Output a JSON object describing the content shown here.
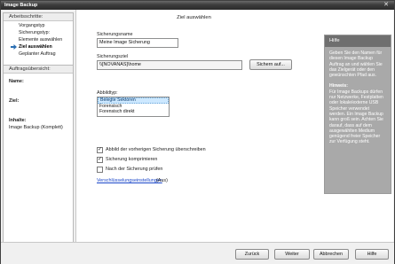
{
  "window": {
    "title": "Image Backup",
    "close_glyph": "✕"
  },
  "steps": {
    "header": "Arbeitsschritte:",
    "items": [
      {
        "label": "Vorgangstyp"
      },
      {
        "label": "Sicherungstyp:"
      },
      {
        "label": "Elemente auswählen"
      },
      {
        "label": "Ziel auswählen",
        "current": true
      },
      {
        "label": "Geplanter Auftrag"
      }
    ]
  },
  "summary": {
    "header": "Auftragsübersicht:",
    "name_label": "Name:",
    "ziel_label": "Ziel:",
    "inhalte_label": "Inhalte:",
    "inhalte_value": "Image Backup (Komplett)"
  },
  "main": {
    "title": "Ziel auswählen",
    "name_label": "Sicherungsname",
    "name_value": "Meine Image Sicherung",
    "target_label": "Sicherungsziel",
    "target_value": "\\\\[NOVANAS]\\home",
    "browse_label": "Sichern auf...",
    "image_type_label": "Abbildtyp:",
    "image_type_options": [
      {
        "label": "Belegte Sektoren",
        "selected": true
      },
      {
        "label": "Forensisch"
      },
      {
        "label": "Forensisch direkt"
      }
    ],
    "options": [
      {
        "label": "Abbild der vorherigen Sicherung überschreiben",
        "checked": true
      },
      {
        "label": "Sicherung komprimieren",
        "checked": true
      },
      {
        "label": "Nach der Sicherung prüfen",
        "checked": false
      }
    ],
    "encryption_link": "Verschlüsselungseinstellungen",
    "encryption_status": "(Aus)"
  },
  "help": {
    "title": "Hilfe",
    "text": "Geben Sie den Namen für diesen Image Backup Auftrag an und wählen Sie das Zielgerät oder den gewünschten Pfad aus.",
    "hint_title": "Hinweis:",
    "hint_text": "Für Image Backups dürfen nur Netzwerke, Festplatten oder lokale/externe USB Speicher verwendet werden. Ein Image Backup kann groß sein. Achten Sie darauf, dass auf dem ausgewählten Medium genügend freier Speicher zur Verfügung steht."
  },
  "footer": {
    "back": "Zurück",
    "next": "Weiter",
    "cancel": "Abbrechen",
    "help": "Hilfe"
  },
  "colors": {
    "accent_link": "#1a46c9",
    "help_bg": "#a9a9a9",
    "selection": "#cde8ff"
  },
  "icons": {
    "current_step": "arrow-right-icon"
  }
}
